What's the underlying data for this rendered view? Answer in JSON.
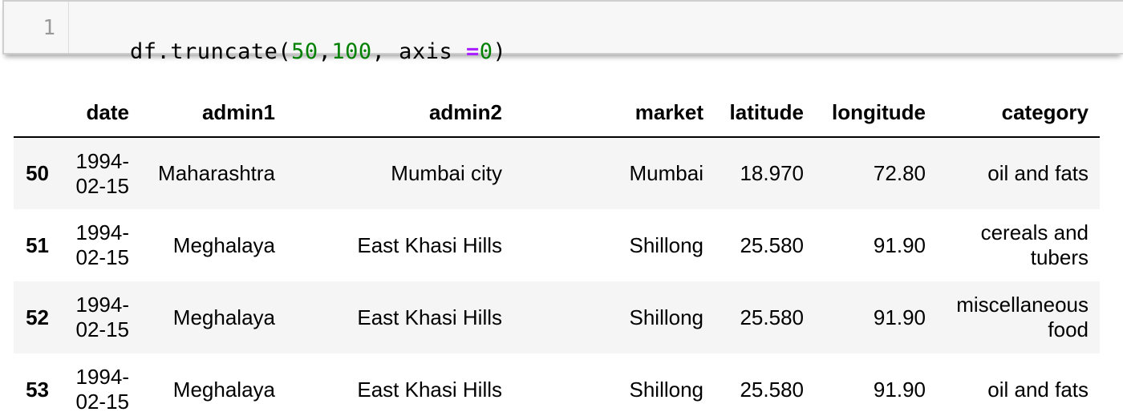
{
  "code_cell": {
    "line_number": "1",
    "tokens": [
      {
        "text": "df.truncate(",
        "kind": "plain"
      },
      {
        "text": "50",
        "kind": "num"
      },
      {
        "text": ",",
        "kind": "plain"
      },
      {
        "text": "100",
        "kind": "num"
      },
      {
        "text": ", axis ",
        "kind": "plain"
      },
      {
        "text": "=",
        "kind": "op"
      },
      {
        "text": "0",
        "kind": "num"
      },
      {
        "text": ")",
        "kind": "plain"
      }
    ]
  },
  "table": {
    "columns": [
      "",
      "date",
      "admin1",
      "admin2",
      "market",
      "latitude",
      "longitude",
      "category"
    ],
    "rows": [
      {
        "index": "50",
        "date": "1994-02-15",
        "admin1": "Maharashtra",
        "admin2": "Mumbai city",
        "market": "Mumbai",
        "latitude": "18.970",
        "longitude": "72.80",
        "category": "oil and fats"
      },
      {
        "index": "51",
        "date": "1994-02-15",
        "admin1": "Meghalaya",
        "admin2": "East Khasi Hills",
        "market": "Shillong",
        "latitude": "25.580",
        "longitude": "91.90",
        "category": "cereals and tubers"
      },
      {
        "index": "52",
        "date": "1994-02-15",
        "admin1": "Meghalaya",
        "admin2": "East Khasi Hills",
        "market": "Shillong",
        "latitude": "25.580",
        "longitude": "91.90",
        "category": "miscellaneous food"
      },
      {
        "index": "53",
        "date": "1994-02-15",
        "admin1": "Meghalaya",
        "admin2": "East Khasi Hills",
        "market": "Shillong",
        "latitude": "25.580",
        "longitude": "91.90",
        "category": "oil and fats"
      }
    ]
  },
  "colors": {
    "number_token": "#008000",
    "operator_token": "#aa22ff",
    "row_stripe": "#f5f5f5"
  }
}
